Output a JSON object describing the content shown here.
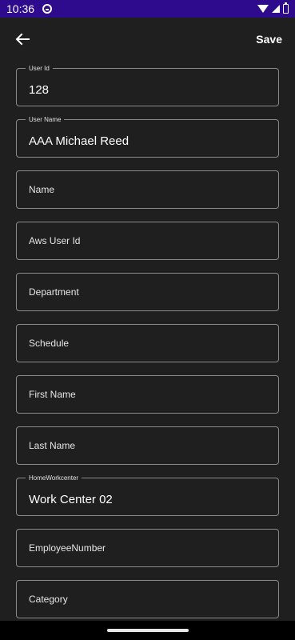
{
  "status_bar": {
    "time": "10:36",
    "icons": [
      "app-notification-icon",
      "wifi-icon",
      "signal-icon",
      "battery-icon"
    ]
  },
  "toolbar": {
    "back_icon": "arrow-left-icon",
    "save_label": "Save"
  },
  "fields": [
    {
      "label": "User Id",
      "value": "128"
    },
    {
      "label": "User Name",
      "value": "AAA Michael Reed"
    },
    {
      "placeholder": "Name"
    },
    {
      "placeholder": "Aws User Id"
    },
    {
      "placeholder": "Department"
    },
    {
      "placeholder": "Schedule"
    },
    {
      "placeholder": "First Name"
    },
    {
      "placeholder": "Last Name"
    },
    {
      "label": "HomeWorkcenter",
      "value": "Work Center 02"
    },
    {
      "placeholder": "EmployeeNumber"
    },
    {
      "placeholder": "Category"
    }
  ],
  "colors": {
    "status_bar": "#2e0a8c",
    "background": "#1f1f1f",
    "field_border": "#8a8a8a"
  }
}
